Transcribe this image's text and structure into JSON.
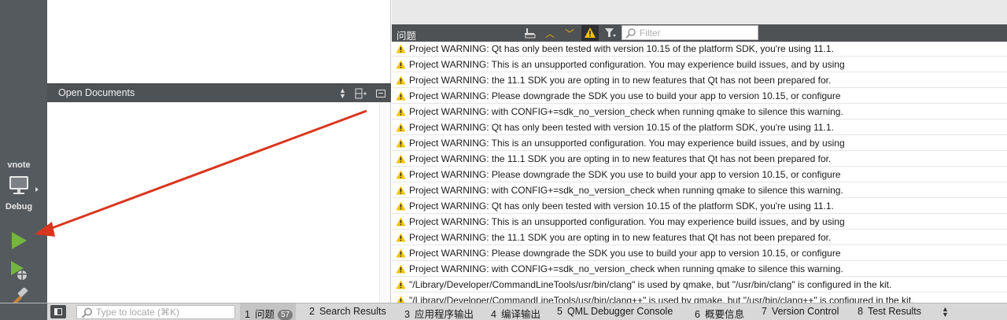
{
  "modebar": {
    "kit_name": "vnote",
    "kit_target": "Debug",
    "icons": [
      "monitor-icon",
      "run-icon",
      "debug-run-icon",
      "hammer-icon"
    ],
    "colors": {
      "run_green": "#74b63f"
    }
  },
  "open_documents": {
    "title": "Open Documents"
  },
  "issues": {
    "title": "问题",
    "filter_placeholder": "Filter",
    "warning_color": "#f5c300",
    "rows": [
      "Project WARNING: Qt has only been tested with version 10.15 of the platform SDK, you're using 11.1.",
      "Project WARNING: This is an unsupported configuration. You may experience build issues, and by using",
      "Project WARNING: the 11.1 SDK you are opting in to new features that Qt has not been prepared for.",
      "Project WARNING: Please downgrade the SDK you use to build your app to version 10.15, or configure",
      "Project WARNING: with CONFIG+=sdk_no_version_check when running qmake to silence this warning.",
      "Project WARNING: Qt has only been tested with version 10.15 of the platform SDK, you're using 11.1.",
      "Project WARNING: This is an unsupported configuration. You may experience build issues, and by using",
      "Project WARNING: the 11.1 SDK you are opting in to new features that Qt has not been prepared for.",
      "Project WARNING: Please downgrade the SDK you use to build your app to version 10.15, or configure",
      "Project WARNING: with CONFIG+=sdk_no_version_check when running qmake to silence this warning.",
      "Project WARNING: Qt has only been tested with version 10.15 of the platform SDK, you're using 11.1.",
      "Project WARNING: This is an unsupported configuration. You may experience build issues, and by using",
      "Project WARNING: the 11.1 SDK you are opting in to new features that Qt has not been prepared for.",
      "Project WARNING: Please downgrade the SDK you use to build your app to version 10.15, or configure",
      "Project WARNING: with CONFIG+=sdk_no_version_check when running qmake to silence this warning.",
      "\"/Library/Developer/CommandLineTools/usr/bin/clang\" is used by qmake, but \"/usr/bin/clang\" is configured in the kit.",
      "\"/Library/Developer/CommandLineTools/usr/bin/clang++\" is used by qmake, but \"/usr/bin/clang++\" is configured in the kit."
    ]
  },
  "bottombar": {
    "locator_placeholder": "Type to locate (⌘K)",
    "tabs": [
      {
        "num": "1",
        "label": "问题",
        "badge": "57"
      },
      {
        "num": "2",
        "label": "Search Results"
      },
      {
        "num": "3",
        "label": "应用程序输出"
      },
      {
        "num": "4",
        "label": "编译输出"
      },
      {
        "num": "5",
        "label": "QML Debugger Console"
      },
      {
        "num": "6",
        "label": "概要信息"
      },
      {
        "num": "7",
        "label": "Version Control"
      },
      {
        "num": "8",
        "label": "Test Results"
      }
    ]
  },
  "annotation": {
    "color": "#d9361f"
  }
}
